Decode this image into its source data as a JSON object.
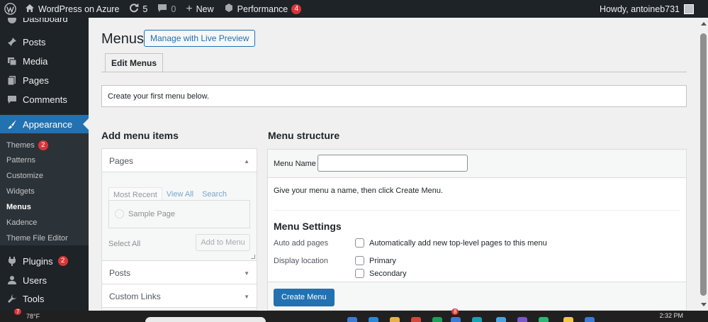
{
  "adminbar": {
    "site_name": "WordPress on Azure",
    "updates_count": "5",
    "comments_count": "0",
    "new_label": "New",
    "performance_label": "Performance",
    "performance_badge": "4",
    "howdy": "Howdy, antoineb731"
  },
  "sidebar": {
    "items": [
      {
        "label": "Dashboard",
        "icon": "dashboard-icon"
      },
      {
        "label": "Posts",
        "icon": "pin-icon"
      },
      {
        "label": "Media",
        "icon": "media-icon"
      },
      {
        "label": "Pages",
        "icon": "pages-icon"
      },
      {
        "label": "Comments",
        "icon": "comment-icon"
      },
      {
        "label": "Appearance",
        "icon": "brush-icon"
      },
      {
        "label": "Plugins",
        "icon": "plugin-icon",
        "badge": "2"
      },
      {
        "label": "Users",
        "icon": "users-icon"
      },
      {
        "label": "Tools",
        "icon": "wrench-icon"
      }
    ],
    "submenu": [
      {
        "label": "Themes",
        "badge": "2"
      },
      {
        "label": "Patterns"
      },
      {
        "label": "Customize"
      },
      {
        "label": "Widgets"
      },
      {
        "label": "Menus"
      },
      {
        "label": "Kadence"
      },
      {
        "label": "Theme File Editor"
      }
    ]
  },
  "main": {
    "title": "Menus",
    "live_preview_button": "Manage with Live Preview",
    "tab_edit_menus": "Edit Menus",
    "notice": "Create your first menu below.",
    "add_items_title": "Add menu items",
    "structure_title": "Menu structure"
  },
  "add_items": {
    "pages_label": "Pages",
    "tabs": [
      "Most Recent",
      "View All",
      "Search"
    ],
    "sample_page": "Sample Page",
    "select_all": "Select All",
    "add_to_menu": "Add to Menu",
    "posts_label": "Posts",
    "custom_links_label": "Custom Links"
  },
  "structure": {
    "menu_name_label": "Menu Name",
    "menu_name_value": "",
    "instructions": "Give your menu a name, then click Create Menu.",
    "settings_title": "Menu Settings",
    "auto_add_label": "Auto add pages",
    "auto_add_option": "Automatically add new top-level pages to this menu",
    "display_location_label": "Display location",
    "locations": [
      "Primary",
      "Secondary"
    ],
    "create_button": "Create Menu"
  },
  "taskbar": {
    "weather_badge": "7",
    "weather": "78°F",
    "app_badge": "8",
    "time": "2:32 PM"
  },
  "colors": {
    "admin_dark": "#1d2327",
    "accent": "#2271b1",
    "badge": "#d63638"
  }
}
